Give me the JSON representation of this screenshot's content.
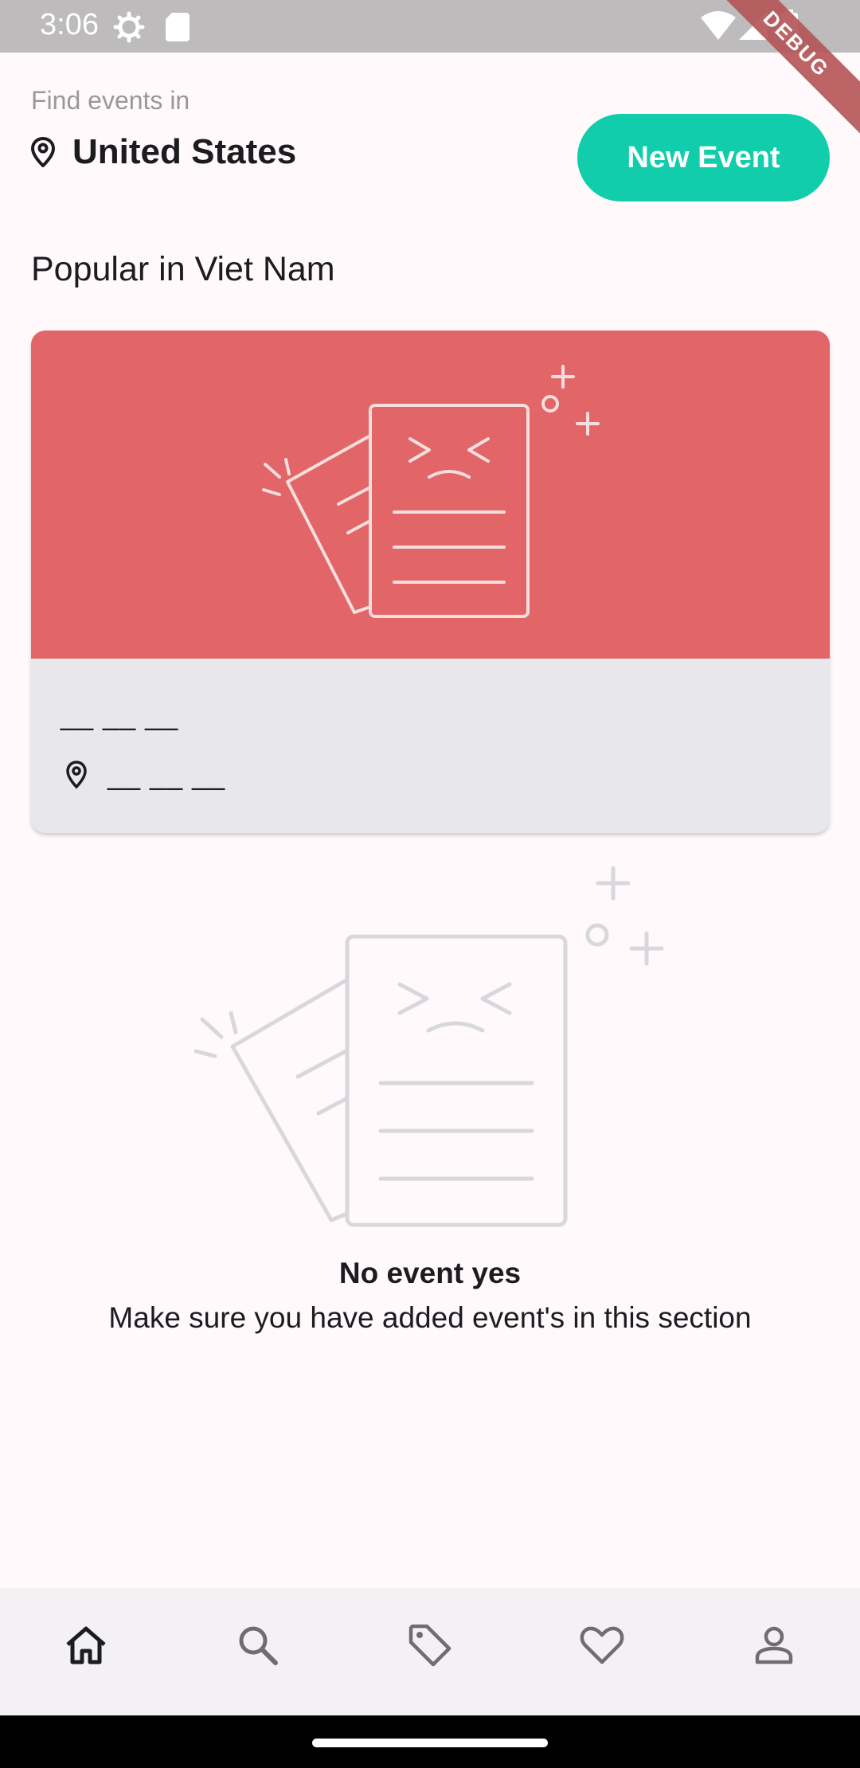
{
  "status_bar": {
    "time": "3:06",
    "icons": [
      "settings-gear-icon",
      "sd-card-icon",
      "wifi-icon",
      "signal-icon",
      "battery-icon"
    ]
  },
  "debug_banner": "DEBUG",
  "header": {
    "find_label": "Find events in",
    "location": "United States",
    "new_event_label": "New Event"
  },
  "popular": {
    "title": "Popular in Viet Nam",
    "card": {
      "date_placeholder": "__ __ __",
      "place_placeholder": "__ __ __",
      "banner_color": "#e26567"
    }
  },
  "empty_state": {
    "title": "No event yes",
    "description": "Make sure you have added event's in this section"
  },
  "bottom_nav": {
    "items": [
      {
        "icon": "home-icon",
        "active": true
      },
      {
        "icon": "search-icon",
        "active": false
      },
      {
        "icon": "tag-icon",
        "active": false
      },
      {
        "icon": "heart-icon",
        "active": false
      },
      {
        "icon": "profile-icon",
        "active": false
      }
    ]
  },
  "colors": {
    "accent": "#12cdab",
    "card_banner": "#e26567",
    "card_body": "#e8e7eb",
    "background": "#fff9fc"
  }
}
